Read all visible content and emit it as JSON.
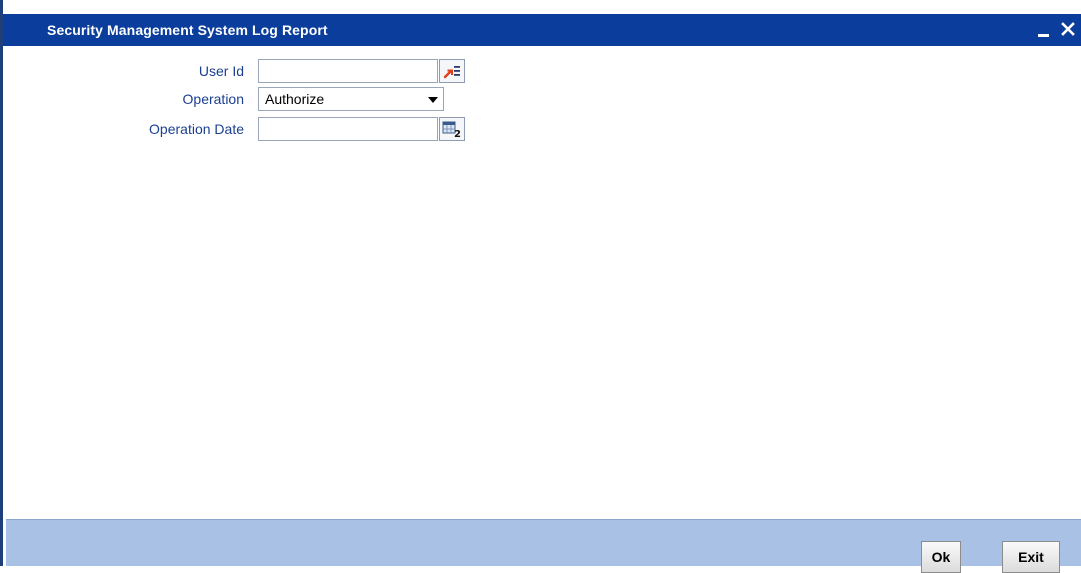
{
  "window": {
    "title": "Security Management System Log Report"
  },
  "form": {
    "user_id": {
      "label": "User Id",
      "value": ""
    },
    "operation": {
      "label": "Operation",
      "selected": "Authorize"
    },
    "operation_date": {
      "label": "Operation Date",
      "value": ""
    }
  },
  "buttons": {
    "ok": "Ok",
    "exit": "Exit"
  },
  "icons": {
    "lookup": "lookup-list-icon",
    "calendar": "calendar-icon",
    "minimize": "minimize-icon",
    "close": "close-icon"
  },
  "colors": {
    "titlebar": "#0a3d9c",
    "label": "#1c3f92",
    "footer": "#a8c1e4"
  }
}
